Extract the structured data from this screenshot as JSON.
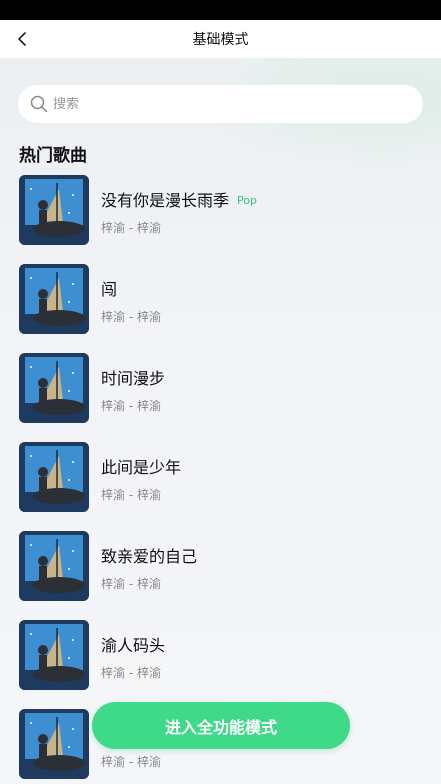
{
  "nav": {
    "title": "基础模式",
    "back_icon": "chevron-left-icon"
  },
  "search": {
    "placeholder": "搜索",
    "value": "",
    "icon": "search-icon"
  },
  "section": {
    "title": "热门歌曲"
  },
  "songs": [
    {
      "title": "没有你是漫长雨季",
      "tag": "Pop",
      "artist": "梓渝 - 梓渝"
    },
    {
      "title": "闯",
      "tag": "",
      "artist": "梓渝 - 梓渝"
    },
    {
      "title": "时间漫步",
      "tag": "",
      "artist": "梓渝 - 梓渝"
    },
    {
      "title": "此间是少年",
      "tag": "",
      "artist": "梓渝 - 梓渝"
    },
    {
      "title": "致亲爱的自己",
      "tag": "",
      "artist": "梓渝 - 梓渝"
    },
    {
      "title": "渝人码头",
      "tag": "",
      "artist": "梓渝 - 梓渝"
    },
    {
      "title": "",
      "tag": "",
      "artist": "梓渝 - 梓渝"
    }
  ],
  "cta": {
    "label": "进入全功能模式"
  },
  "colors": {
    "accent": "#3fd98a",
    "tag": "#33c97a",
    "status_bar": "#000000"
  }
}
